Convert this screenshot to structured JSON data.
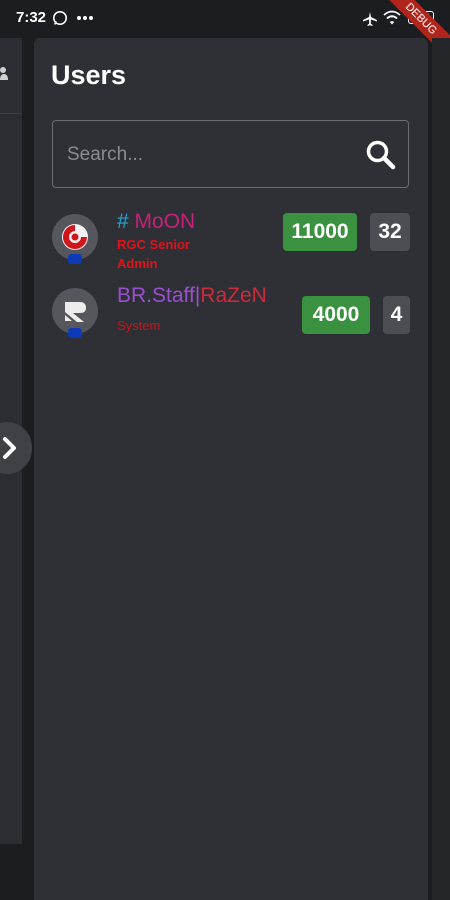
{
  "status_bar": {
    "time": "7:32",
    "icons": [
      "whatsapp-icon",
      "more-dots-icon",
      "airplane-icon",
      "wifi-icon",
      "battery-icon"
    ],
    "battery": "79",
    "debug_banner": "DEBUG"
  },
  "panel": {
    "title": "Users"
  },
  "search": {
    "placeholder": "Search..."
  },
  "users": [
    {
      "name_prefix": "# ",
      "name_main": "MoON",
      "role": "RGC Senior Admin",
      "points": "11000",
      "count": "32",
      "prefix_color": "#29a3d6",
      "name_color": "#c8217a",
      "role_color": "#e0131b"
    },
    {
      "name_prefix": "BR.Staff|",
      "name_main": "RaZeN",
      "role": "System",
      "points": "4000",
      "count": "4",
      "prefix_color": "#9b4fd0",
      "name_color": "#cc2b3c",
      "role_color": "#c4161b"
    }
  ],
  "colors": {
    "background": "#1c1d21",
    "panel": "#2e3035",
    "points_badge": "#3a9140",
    "count_badge": "#4c4e53"
  }
}
